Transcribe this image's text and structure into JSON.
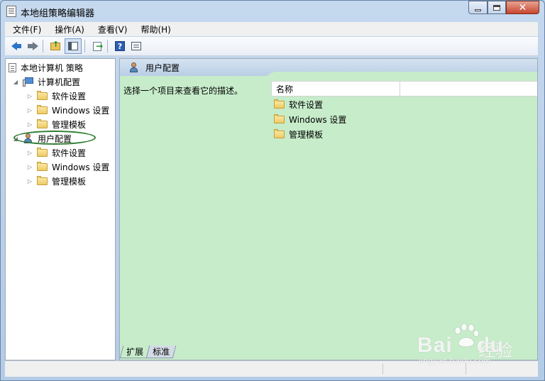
{
  "window": {
    "title": "本地组策略编辑器",
    "controls": {
      "minimize": "minimize-icon",
      "maximize": "maximize-icon",
      "close": "close-icon"
    }
  },
  "menu": [
    "文件(F)",
    "操作(A)",
    "查看(V)",
    "帮助(H)"
  ],
  "toolbar": {
    "buttons": [
      "back-arrow-icon",
      "forward-arrow-icon",
      "up-folder-icon",
      "show-hide-tree-icon",
      "export-list-icon",
      "help-icon",
      "properties-icon"
    ],
    "help_glyph": "?"
  },
  "tree": {
    "root": "本地计算机 策略",
    "computer": {
      "label": "计算机配置",
      "children": [
        "软件设置",
        "Windows 设置",
        "管理模板"
      ]
    },
    "user": {
      "label": "用户配置",
      "children": [
        "软件设置",
        "Windows 设置",
        "管理模板"
      ]
    }
  },
  "right_pane": {
    "header": "用户配置",
    "description": "选择一个项目来查看它的描述。",
    "column_name": "名称",
    "items": [
      "软件设置",
      "Windows 设置",
      "管理模板"
    ]
  },
  "tabs": [
    "扩展",
    "标准"
  ],
  "watermark": {
    "brand": "Bai",
    "brand2": "du",
    "cn": "经验",
    "url": "jingyan.baidu.com"
  },
  "colors": {
    "pane_bg": "#c7ecca",
    "highlight_ellipse": "#2e7d32"
  }
}
